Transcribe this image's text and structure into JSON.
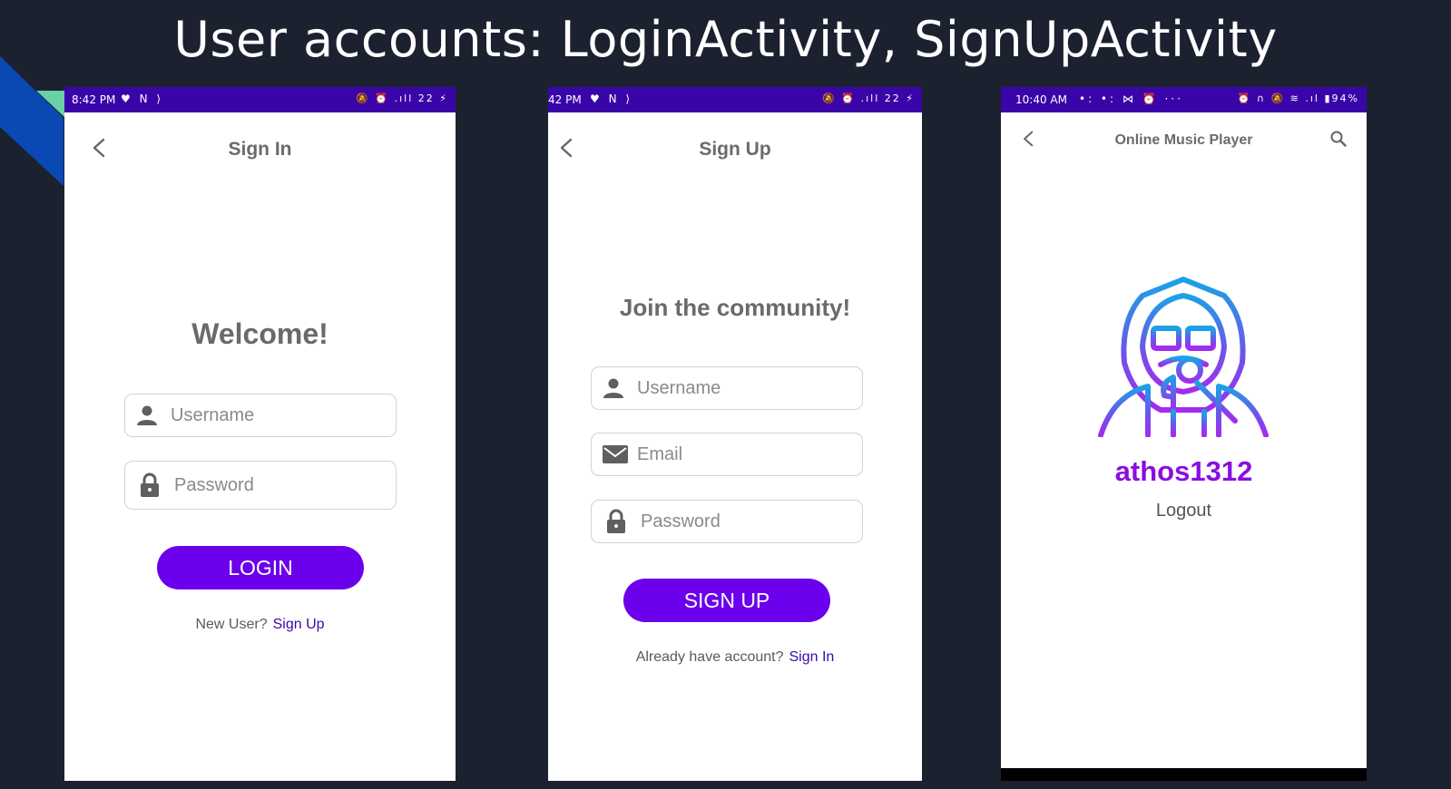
{
  "slide": {
    "title": "User accounts: LoginActivity, SignUpActivity"
  },
  "colors": {
    "background": "#1c2130",
    "statusbar": "#3a05a8",
    "primary_button": "#6c00ec",
    "link": "#3a0aa8",
    "username_accent": "#8a0ee0"
  },
  "login_screen": {
    "status_time": "8:42 PM",
    "status_left_icons": "♥ N ⟩",
    "status_right_icons": "🔕 ⏰ .ıll 22 ⚡",
    "appbar_title": "Sign In",
    "heading": "Welcome!",
    "username_placeholder": "Username",
    "password_placeholder": "Password",
    "login_button": "LOGIN",
    "footer_prompt": "New User?",
    "footer_link": "Sign Up"
  },
  "signup_screen": {
    "status_time": "42 PM",
    "status_left_icons": "♥ N ⟩",
    "status_right_icons": "🔕 ⏰ .ıll 22 ⚡",
    "appbar_title": "Sign Up",
    "heading": "Join the community!",
    "username_placeholder": "Username",
    "email_placeholder": "Email",
    "password_placeholder": "Password",
    "signup_button": "SIGN UP",
    "footer_prompt": "Already have account?",
    "footer_link": "Sign In"
  },
  "profile_screen": {
    "status_time": "10:40 AM",
    "status_left_icons": "•: •: ⋈ ⏰ ···",
    "status_right_icons": "⏰ ∩ 🔕 ≋ .ıl ▮94%",
    "appbar_title": "Online Music Player",
    "username": "athos1312",
    "logout_label": "Logout"
  }
}
